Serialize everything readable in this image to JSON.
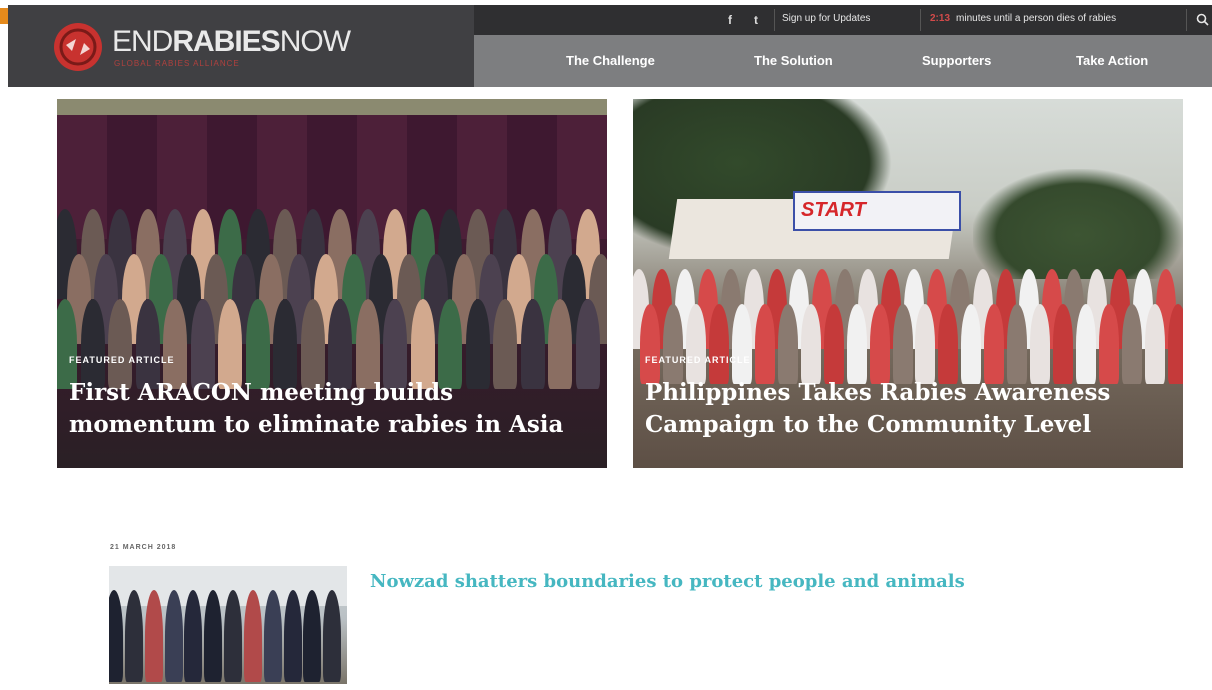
{
  "site": {
    "logo": {
      "part1": "END",
      "part2": "RABIES",
      "part3": "NOW",
      "tagline": "GLOBAL RABIES ALLIANCE"
    },
    "topbar": {
      "social": [
        {
          "icon": "facebook-icon",
          "glyph": "f"
        },
        {
          "icon": "twitter-icon",
          "glyph": "t"
        }
      ],
      "signup_label": "Sign up for Updates",
      "stat_number": "2:13",
      "stat_text": "minutes until a person dies of rabies",
      "search_icon": "search-icon"
    },
    "nav": [
      {
        "label": "The Challenge"
      },
      {
        "label": "The Solution"
      },
      {
        "label": "Supporters"
      },
      {
        "label": "Take Action"
      }
    ]
  },
  "featured": [
    {
      "label": "Featured Article",
      "title": "First ARACON meeting builds momentum to eliminate rabies in Asia"
    },
    {
      "label": "Featured Article",
      "title": "Philippines Takes Rabies Awareness Campaign to the Community Level",
      "banner": "START"
    }
  ],
  "news": {
    "date": "21 March 2018",
    "title": "Nowzad shatters boundaries to protect people and animals"
  },
  "colors": {
    "accent": "#46b7c1",
    "header": "#3b3b3d",
    "nav": "#7d7e80",
    "logo_red": "#c8322f"
  }
}
